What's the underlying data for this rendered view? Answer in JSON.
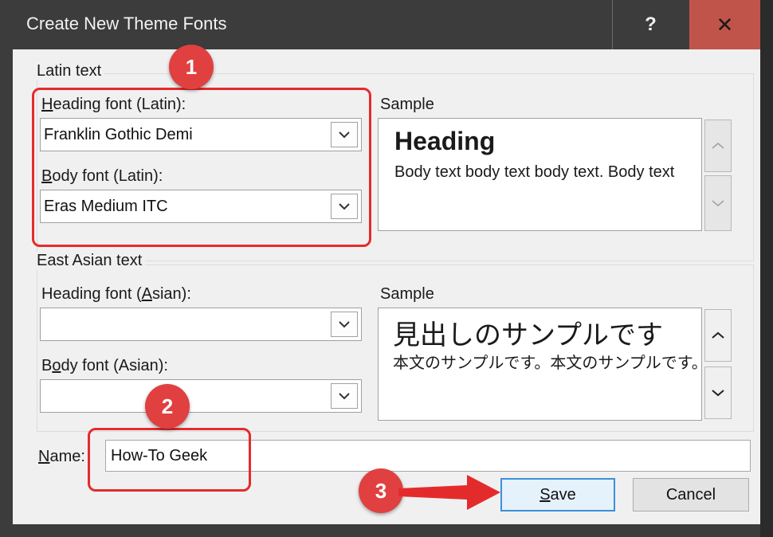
{
  "dialog": {
    "title": "Create New Theme Fonts",
    "help_label": "?",
    "close_label": "✕"
  },
  "latin": {
    "group_label": "Latin text",
    "heading_label_key": "H",
    "heading_label_rest": "eading font (Latin):",
    "heading_value": "Franklin Gothic Demi",
    "body_label_key": "B",
    "body_label_rest": "ody font (Latin):",
    "body_value": "Eras Medium ITC",
    "sample_label": "Sample",
    "sample_heading": "Heading",
    "sample_body": "Body text body text body text. Body text"
  },
  "asian": {
    "group_label": "East Asian text",
    "heading_label_pre": "Heading font (",
    "heading_label_key": "A",
    "heading_label_post": "sian):",
    "heading_value": "",
    "body_label_pre": "B",
    "body_label_key": "o",
    "body_label_post": "dy font (Asian):",
    "body_value": "",
    "sample_label": "Sample",
    "sample_heading": "見出しのサンプルです",
    "sample_body": "本文のサンプルです。本文のサンプルです。"
  },
  "name": {
    "label_key": "N",
    "label_rest": "ame:",
    "value": "How-To Geek"
  },
  "buttons": {
    "save_key": "S",
    "save_rest": "ave",
    "cancel": "Cancel"
  },
  "annotations": {
    "step1": "1",
    "step2": "2",
    "step3": "3",
    "color": "#e42b2b"
  }
}
